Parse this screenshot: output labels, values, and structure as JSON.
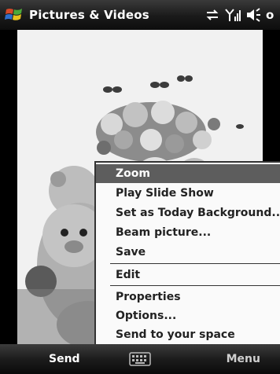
{
  "titlebar": {
    "title": "Pictures & Videos",
    "clock": "o",
    "icons": [
      "windows-start-icon",
      "connectivity-icon",
      "signal-icon",
      "volume-icon"
    ]
  },
  "menu": {
    "items": [
      {
        "label": "Zoom",
        "selected": true
      },
      {
        "label": "Play Slide Show"
      },
      {
        "label": "Set as Today Background..."
      },
      {
        "label": "Beam picture..."
      },
      {
        "label": "Save"
      },
      {
        "label": "Edit"
      },
      {
        "label": "Properties"
      },
      {
        "label": "Options..."
      },
      {
        "label": "Send to your space"
      }
    ]
  },
  "softkeys": {
    "left": "Send",
    "right": "Menu",
    "center_icon": "keyboard-icon"
  },
  "colors": {
    "bar": "#1a1a1a",
    "menu_bg": "#fafafa",
    "selected_bg": "#5d5d5d"
  }
}
